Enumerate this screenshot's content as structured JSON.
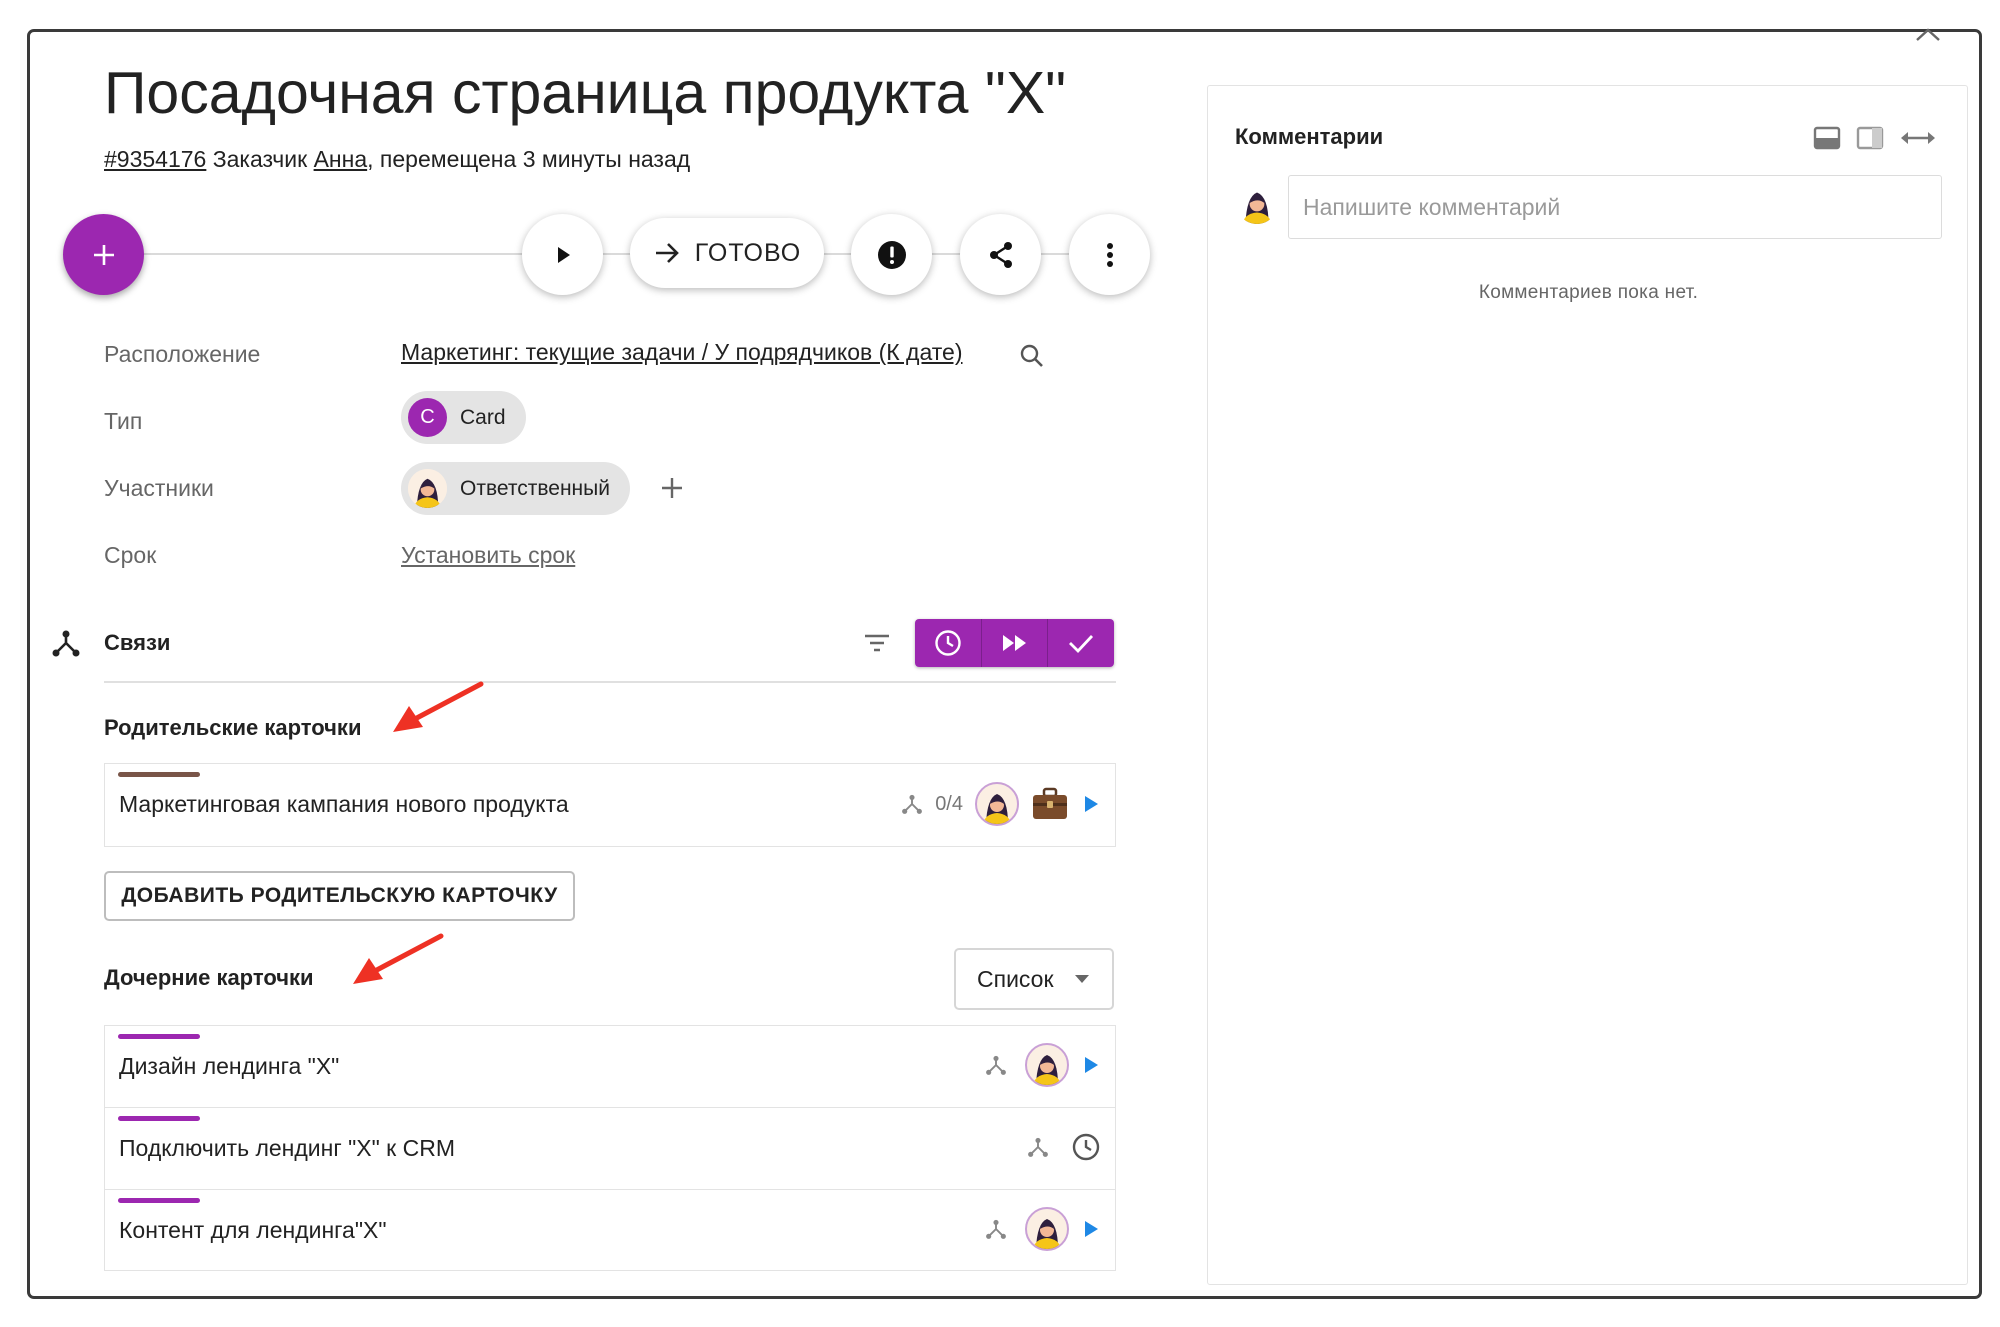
{
  "card": {
    "title": "Посадочная страница продукта \"X\"",
    "id_link": "#9354176",
    "customer_prefix": " Заказчик ",
    "customer_name": "Анна",
    "moved_text": ", перемещена 3 минуты назад"
  },
  "toolbar": {
    "done_label": "ГОТОВО"
  },
  "properties": {
    "location_label": "Расположение",
    "location_value": "Маркетинг: текущие задачи / У подрядчиков (К дате)",
    "type_label": "Тип",
    "type_letter": "C",
    "type_value": "Card",
    "members_label": "Участники",
    "member_value": "Ответственный",
    "deadline_label": "Срок",
    "deadline_value": "Установить срок"
  },
  "relations": {
    "title": "Связи",
    "parents_title": "Родительские карточки",
    "parents": [
      {
        "name": "Маркетинговая кампания нового продукта",
        "children_count": "0/4",
        "bar_color": "#795548"
      }
    ],
    "add_parent_label": "ДОБАВИТЬ РОДИТЕЛЬСКУЮ КАРТОЧКУ",
    "children_title": "Дочерние карточки",
    "view_mode": "Список",
    "children": [
      {
        "name": "Дизайн лендинга \"X\"",
        "bar_color": "#9c27b0"
      },
      {
        "name": "Подключить лендинг \"X\" к CRM",
        "bar_color": "#9c27b0"
      },
      {
        "name": "Контент для лендинга\"X\"",
        "bar_color": "#9c27b0"
      }
    ]
  },
  "comments": {
    "title": "Комментарии",
    "input_placeholder": "Напишите комментарий",
    "empty_text": "Комментариев пока нет."
  },
  "colors": {
    "accent": "#9c27b0",
    "play": "#1e88e5",
    "annotation_arrow": "#ee3124"
  }
}
